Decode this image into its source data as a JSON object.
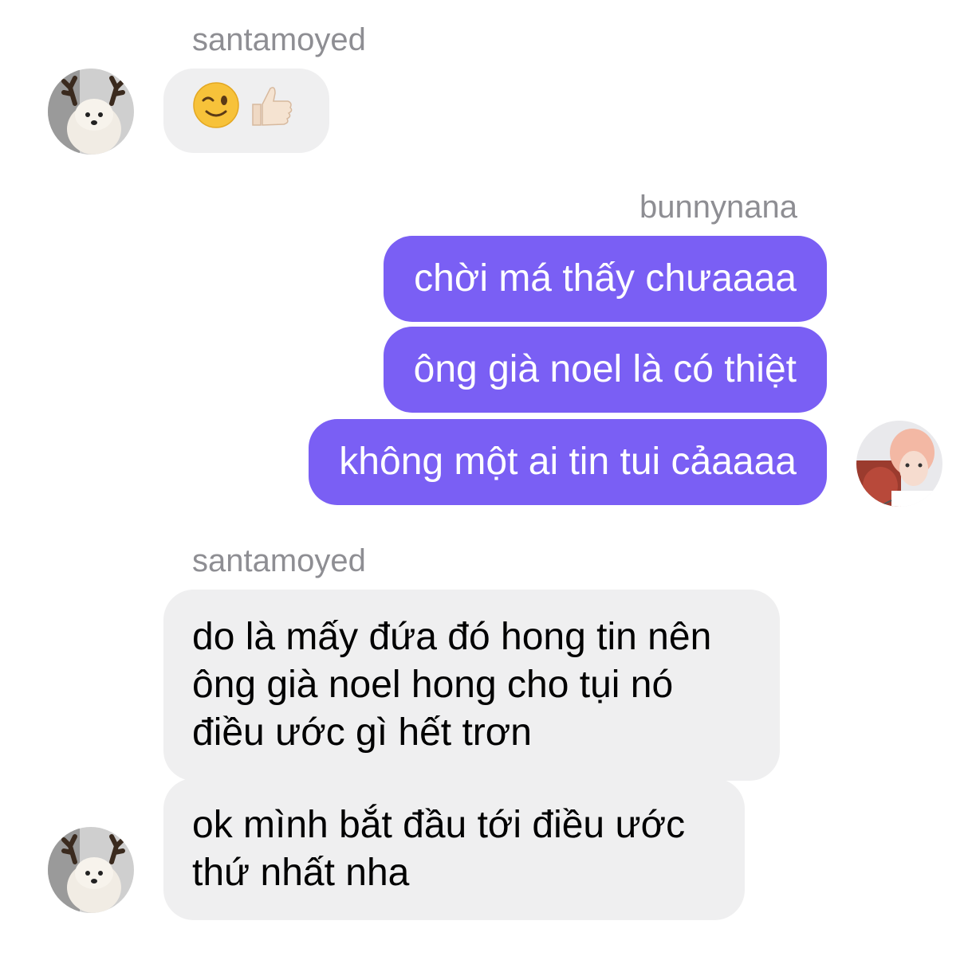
{
  "messages": [
    {
      "sender": "santamoyed",
      "text": "😉👍🏻"
    },
    {
      "sender": "bunnynana",
      "lines": [
        "chời má thấy chưaaaa",
        "ông già noel là có thiệt",
        "không một ai tin tui cảaaaa"
      ]
    },
    {
      "sender": "santamoyed",
      "lines": [
        "do là mấy đứa đó hong tin nên ông già noel hong cho tụi nó điều ước gì hết trơn",
        "ok mình bắt đầu tới điều ước thứ nhất nha"
      ]
    }
  ],
  "colors": {
    "outgoing_bubble": "#7a5ff4",
    "incoming_bubble": "#efeff0",
    "sender_name": "#8e8e93"
  },
  "icons": {
    "samoyed_avatar": "samoyed-avatar-icon",
    "bunny_avatar": "bunnynana-avatar-icon",
    "wink": "wink-emoji-icon",
    "thumbs_up": "thumbs-up-emoji-icon"
  }
}
